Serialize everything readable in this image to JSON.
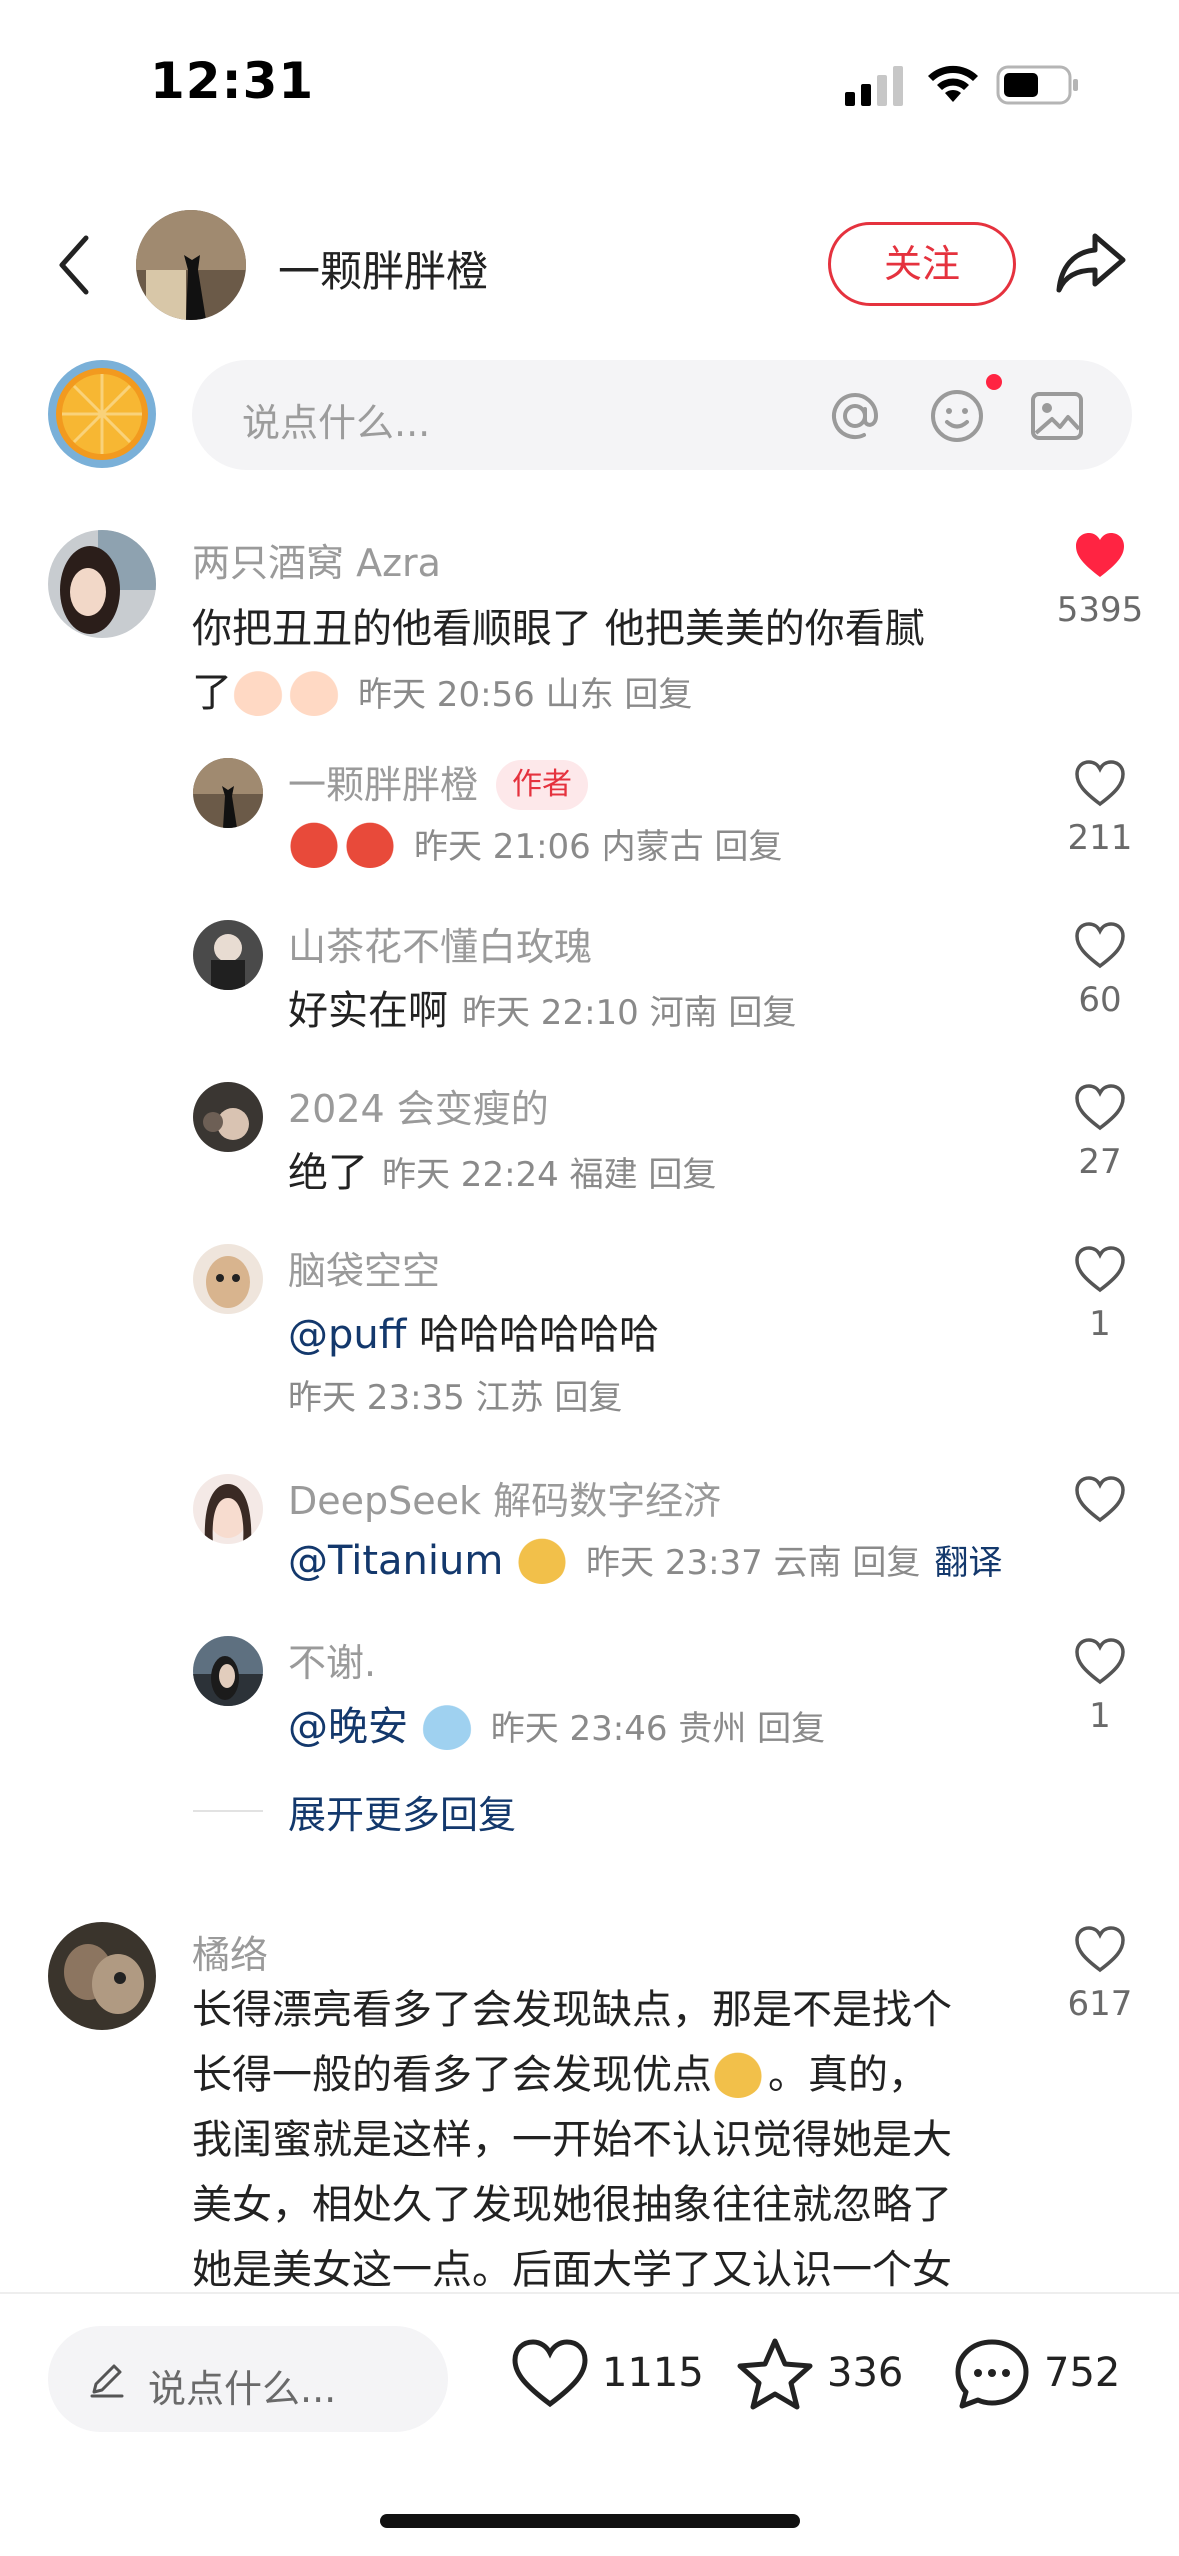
{
  "status_bar": {
    "time": "12:31"
  },
  "header": {
    "name": "一颗胖胖橙",
    "follow_label": "关注"
  },
  "comment_input": {
    "placeholder": "说点什么..."
  },
  "comments": [
    {
      "name": "两只酒窝 Azra",
      "text_line1": "你把丑丑的他看顺眼了 他把美美的你看腻",
      "text_line2": "了",
      "meta": "昨天 20:56 山东 回复",
      "likes": "5395",
      "liked": true
    }
  ],
  "replies": [
    {
      "name": "一颗胖胖橙",
      "author_tag": "作者",
      "text": "",
      "meta": "昨天 21:06 内蒙古 回复",
      "likes": "211"
    },
    {
      "name": "山茶花不懂白玫瑰",
      "text": "好实在啊",
      "meta": "昨天 22:10 河南 回复",
      "likes": "60"
    },
    {
      "name": "2024 会变瘦的",
      "text": "绝了",
      "meta": "昨天 22:24 福建 回复",
      "likes": "27"
    },
    {
      "name": "脑袋空空",
      "mention": "@puff",
      "text": " 哈哈哈哈哈哈",
      "meta": "昨天 23:35 江苏 回复",
      "likes": "1"
    },
    {
      "name": "DeepSeek 解码数字经济",
      "mention": "@Titanium",
      "text": "",
      "meta": "昨天 23:37 云南 回复",
      "translate": "翻译",
      "likes": ""
    },
    {
      "name": "不谢.",
      "mention": "@晚安",
      "text": "",
      "meta": "昨天 23:46 贵州 回复",
      "likes": "1"
    }
  ],
  "expand_more": "展开更多回复",
  "second_comment": {
    "name": "橘络",
    "likes": "617",
    "lines": [
      "长得漂亮看多了会发现缺点，那是不是找个",
      "长得一般的看多了会发现优点",
      "我闺蜜就是这样，一开始不认识觉得她是大",
      "美女，相处久了发现她很抽象往往就忽略了",
      "她是美女这一点。后面大学了又认识一个女"
    ],
    "line2_suffix": "。真的，"
  },
  "bottom_bar": {
    "placeholder": "说点什么...",
    "likes": "1115",
    "favorites": "336",
    "comments": "752"
  },
  "colors": {
    "accent": "#e5323e",
    "link": "#13386c",
    "heart": "#ff2442"
  }
}
